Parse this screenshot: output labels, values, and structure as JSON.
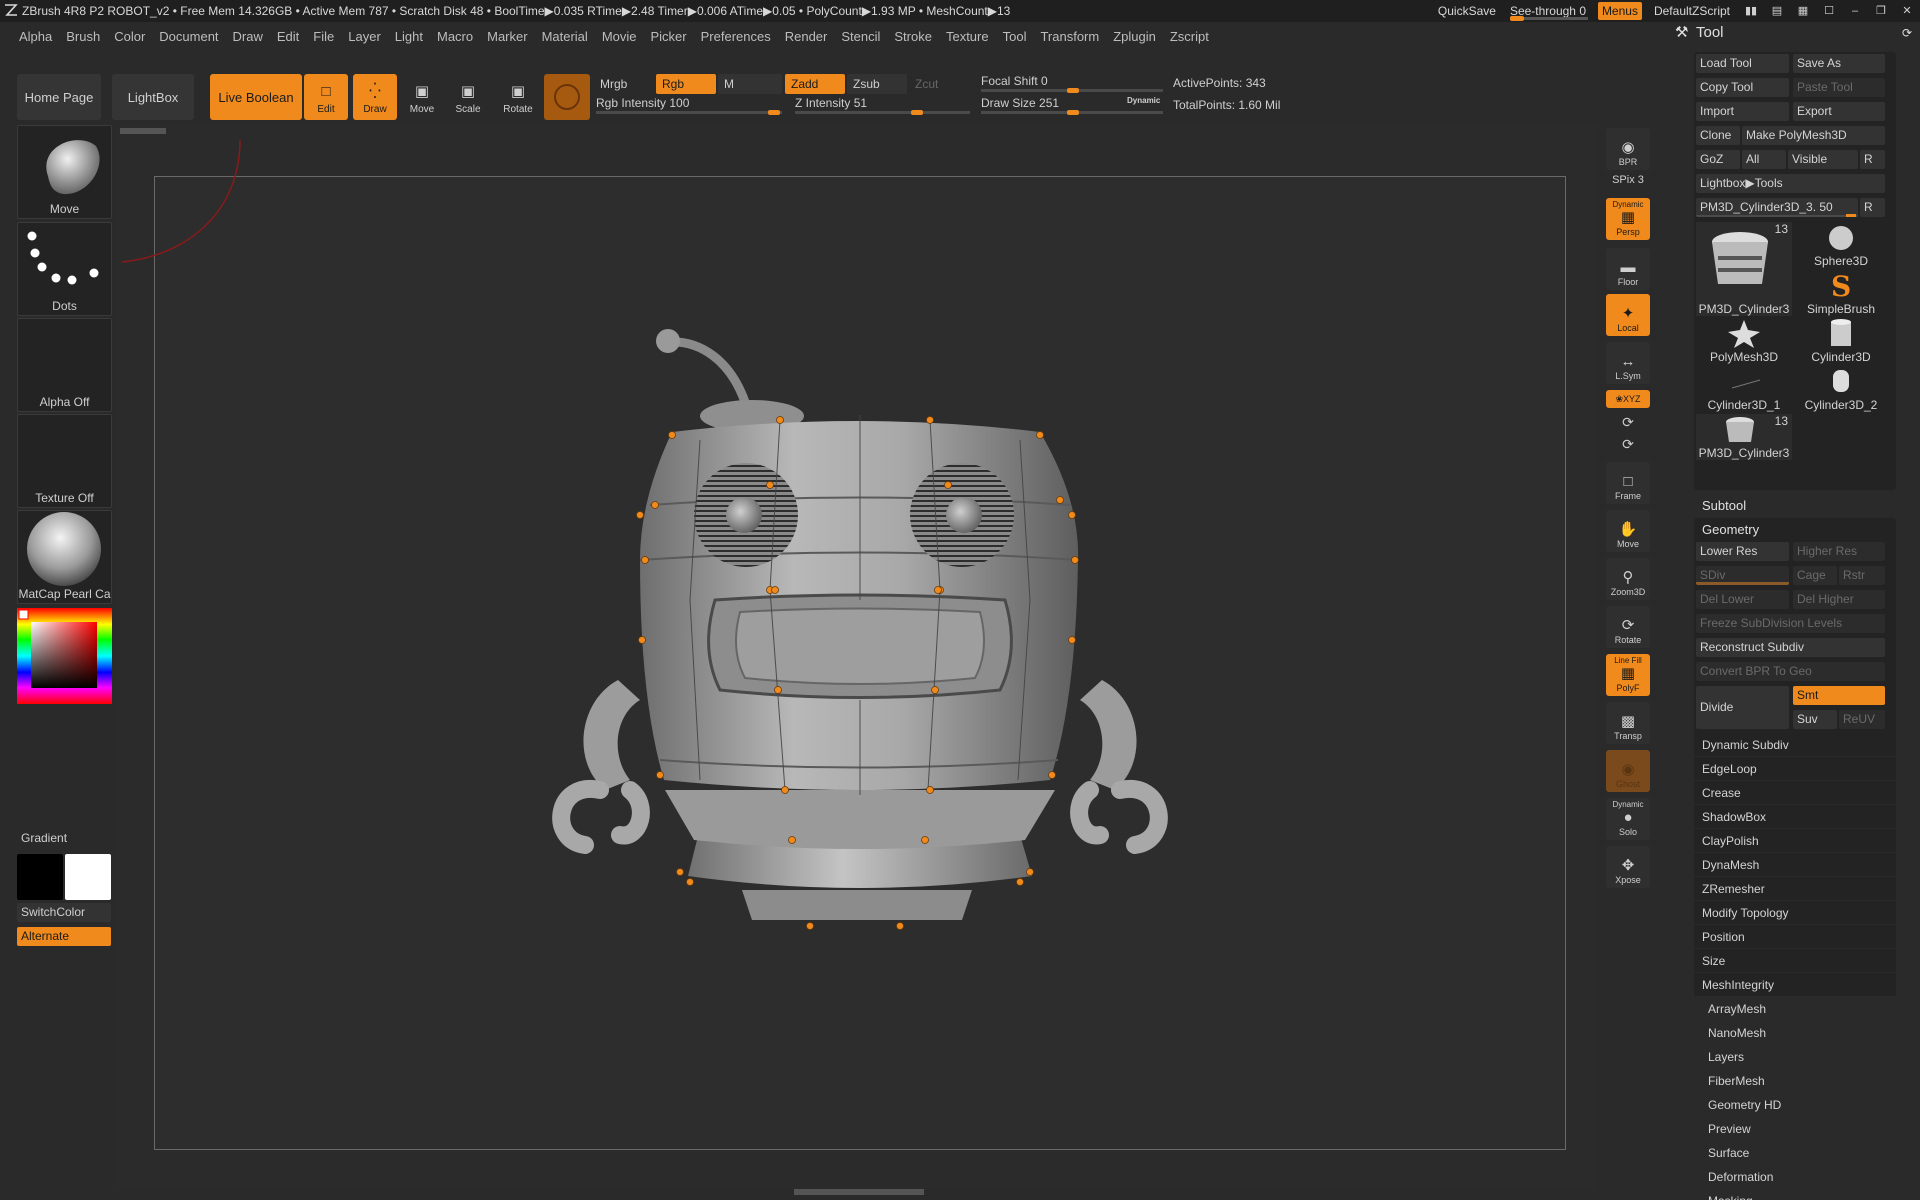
{
  "titlebar": {
    "text": "ZBrush 4R8 P2    ROBOT_v2    • Free Mem 14.326GB • Active Mem 787 • Scratch Disk 48 •  BoolTime▶0.035 RTime▶2.48 Timer▶0.006 ATime▶0.05 • PolyCount▶1.93 MP  • MeshCount▶13",
    "quicksave": "QuickSave",
    "seethrough": "See-through  0",
    "menus": "Menus",
    "script": "DefaultZScript"
  },
  "menubar": [
    "Alpha",
    "Brush",
    "Color",
    "Document",
    "Draw",
    "Edit",
    "File",
    "Layer",
    "Light",
    "Macro",
    "Marker",
    "Material",
    "Movie",
    "Picker",
    "Preferences",
    "Render",
    "Stencil",
    "Stroke",
    "Texture",
    "Tool",
    "Transform",
    "Zplugin",
    "Zscript"
  ],
  "shelf": {
    "home_page": "Home Page",
    "lightbox": "LightBox",
    "live_boolean": "Live Boolean",
    "edit": "Edit",
    "draw": "Draw",
    "move": "Move",
    "scale": "Scale",
    "rotate": "Rotate",
    "mrgb": "Mrgb",
    "rgb": "Rgb",
    "m": "M",
    "zadd": "Zadd",
    "zsub": "Zsub",
    "zcut": "Zcut",
    "rgb_intensity": "Rgb Intensity 100",
    "z_intensity": "Z Intensity 51",
    "focal_shift": "Focal Shift 0",
    "draw_size": "Draw Size 251",
    "dynamic": "Dynamic",
    "active_points": "ActivePoints: 343",
    "total_points": "TotalPoints: 1.60 Mil"
  },
  "lefttray": {
    "brush": "Move",
    "stroke": "Dots",
    "alpha": "Alpha Off",
    "texture": "Texture Off",
    "material": "MatCap Pearl Ca",
    "gradient": "Gradient",
    "switchcolor": "SwitchColor",
    "alternate": "Alternate"
  },
  "rightshelf": {
    "bpr": "BPR",
    "spix": "SPix 3",
    "persp": "Persp",
    "dynamic": "Dynamic",
    "floor": "Floor",
    "local": "Local",
    "lsym": "L.Sym",
    "xyz": "❀XYZ",
    "frame": "Frame",
    "move": "Move",
    "zoom3d": "Zoom3D",
    "rotate": "Rotate",
    "linefill": "Line Fill",
    "polyf": "PolyF",
    "transp": "Transp",
    "ghost": "Ghost",
    "solo_dynamic": "Dynamic",
    "solo": "Solo",
    "xpose": "Xpose"
  },
  "toolpanel": {
    "title": "Tool",
    "load_tool": "Load Tool",
    "save_as": "Save As",
    "copy_tool": "Copy Tool",
    "paste_tool": "Paste Tool",
    "import": "Import",
    "export": "Export",
    "clone": "Clone",
    "make_polymesh": "Make PolyMesh3D",
    "goz": "GoZ",
    "all": "All",
    "visible": "Visible",
    "r": "R",
    "lightbox_tools": "Lightbox▶Tools",
    "current_tool": "PM3D_Cylinder3D_3. 50",
    "thumbs": [
      {
        "label": "PM3D_Cylinder3",
        "count": "13"
      },
      {
        "label": "Sphere3D",
        "count": ""
      },
      {
        "label": "SimpleBrush",
        "count": ""
      },
      {
        "label": "PolyMesh3D",
        "count": ""
      },
      {
        "label": "Cylinder3D",
        "count": ""
      },
      {
        "label": "Cylinder3D_1",
        "count": ""
      },
      {
        "label": "Cylinder3D_2",
        "count": ""
      },
      {
        "label": "PM3D_Cylinder3",
        "count": "13"
      }
    ],
    "subtool": "Subtool",
    "geometry": "Geometry",
    "lower_res": "Lower Res",
    "higher_res": "Higher Res",
    "sdiv": "SDiv",
    "cage": "Cage",
    "rstr": "Rstr",
    "del_lower": "Del Lower",
    "del_higher": "Del Higher",
    "freeze": "Freeze SubDivision Levels",
    "reconstruct": "Reconstruct Subdiv",
    "convert_bpr": "Convert BPR To Geo",
    "divide": "Divide",
    "smt": "Smt",
    "suv": "Suv",
    "reuv": "ReUV",
    "geometry_items": [
      "Dynamic Subdiv",
      "EdgeLoop",
      "Crease",
      "ShadowBox",
      "ClayPolish",
      "DynaMesh",
      "ZRemesher",
      "Modify Topology",
      "Position",
      "Size",
      "MeshIntegrity"
    ],
    "sections": [
      "ArrayMesh",
      "NanoMesh",
      "Layers",
      "FiberMesh",
      "Geometry HD",
      "Preview",
      "Surface",
      "Deformation",
      "Masking"
    ]
  }
}
